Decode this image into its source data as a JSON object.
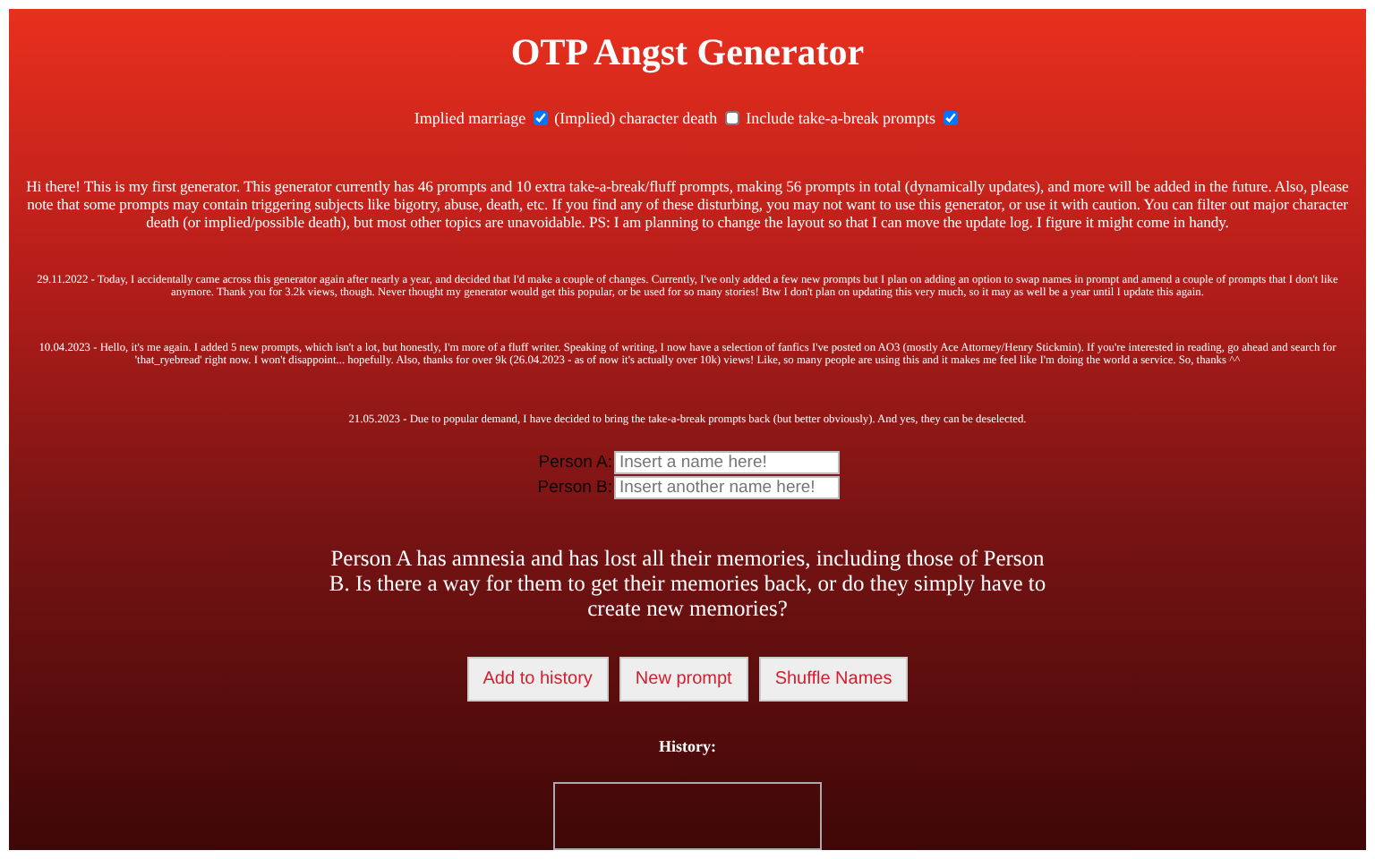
{
  "title": "OTP Angst Generator",
  "options": [
    {
      "label": "Implied marriage",
      "checked": true
    },
    {
      "label": "(Implied) character death",
      "checked": false
    },
    {
      "label": "Include take-a-break prompts",
      "checked": true
    }
  ],
  "intro": "Hi there! This is my first generator. This generator currently has 46 prompts and 10 extra take-a-break/fluff prompts, making 56 prompts in total (dynamically updates), and more will be added in the future. Also, please note that some prompts may contain triggering subjects like bigotry, abuse, death, etc. If you find any of these disturbing, you may not want to use this generator, or use it with caution. You can filter out major character death (or implied/possible death), but most other topics are unavoidable. PS: I am planning to change the layout so that I can move the update log. I figure it might come in handy.",
  "updates": [
    "29.11.2022 - Today, I accidentally came across this generator again after nearly a year, and decided that I'd make a couple of changes. Currently, I've only added a few new prompts but I plan on adding an option to swap names in prompt and amend a couple of prompts that I don't like anymore. Thank you for 3.2k views, though. Never thought my generator would get this popular, or be used for so many stories! Btw I don't plan on updating this very much, so it may as well be a year until I update this again.",
    "10.04.2023 - Hello, it's me again. I added 5 new prompts, which isn't a lot, but honestly, I'm more of a fluff writer. Speaking of writing, I now have a selection of fanfics I've posted on AO3 (mostly Ace Attorney/Henry Stickmin). If you're interested in reading, go ahead and search for 'that_ryebread' right now. I won't disappoint... hopefully. Also, thanks for over 9k (26.04.2023 - as of now it's actually over 10k) views! Like, so many people are using this and it makes me feel like I'm doing the world a service. So, thanks ^^",
    "21.05.2023 - Due to popular demand, I have decided to bring the take-a-break prompts back (but better obviously). And yes, they can be deselected."
  ],
  "fields": [
    {
      "label": "Person A:",
      "placeholder": "Insert a name here!"
    },
    {
      "label": "Person B:",
      "placeholder": "Insert another name here!"
    }
  ],
  "prompt": "Person A has amnesia and has lost all their memories, including those of Person B. Is there a way for them to get their memories back, or do they simply have to create new memories?",
  "buttons": [
    "Add to history",
    "New prompt",
    "Shuffle Names"
  ],
  "history": {
    "label": "History:"
  }
}
